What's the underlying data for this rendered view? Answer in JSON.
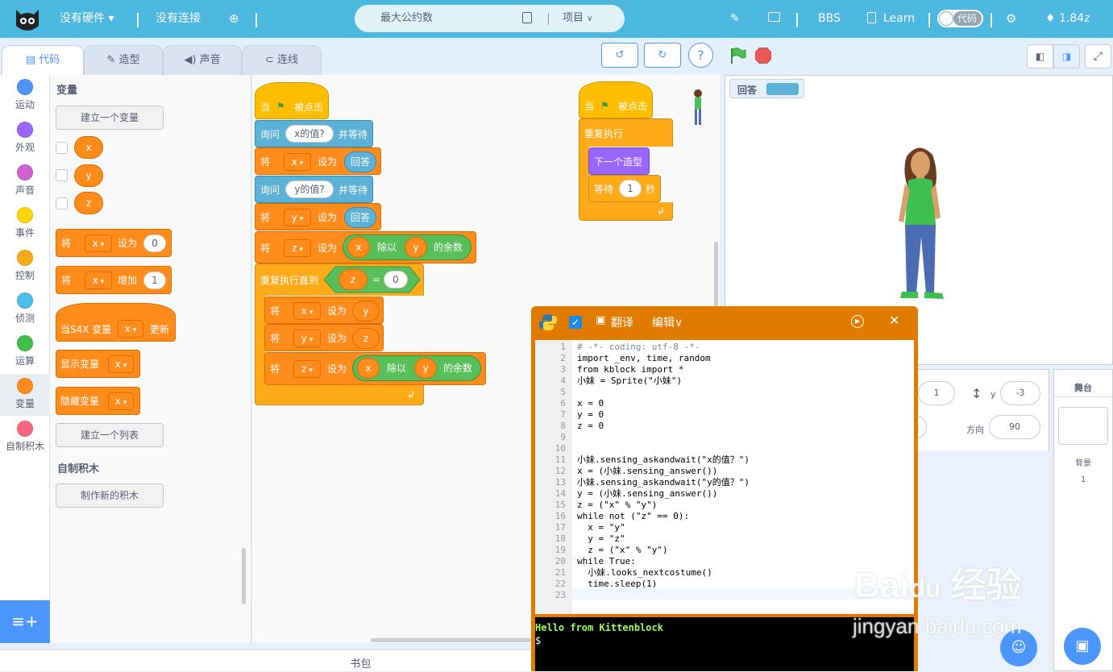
{
  "topbar": {
    "hardware": "没有硬件",
    "connection": "没有连接",
    "project_name": "最大公约数",
    "project_menu": "项目",
    "bbs": "BBS",
    "learn": "Learn",
    "code_toggle": "代码",
    "version": "1.84z"
  },
  "tabs": [
    "代码",
    "造型",
    "声音",
    "连线"
  ],
  "categories": [
    {
      "label": "运动",
      "color": "#4c97ff"
    },
    {
      "label": "外观",
      "color": "#9966ff"
    },
    {
      "label": "声音",
      "color": "#cf63cf"
    },
    {
      "label": "事件",
      "color": "#ffd500"
    },
    {
      "label": "控制",
      "color": "#ffab19"
    },
    {
      "label": "侦测",
      "color": "#4cbfe6"
    },
    {
      "label": "运算",
      "color": "#40bf4a"
    },
    {
      "label": "变量",
      "color": "#ff8c1a"
    },
    {
      "label": "自制积木",
      "color": "#ff6680"
    }
  ],
  "palette": {
    "variables_title": "变量",
    "make_variable": "建立一个变量",
    "vars": [
      "x",
      "y",
      "z"
    ],
    "set_block": {
      "op": "将",
      "var": "x",
      "mid": "设为",
      "val": "0"
    },
    "change_block": {
      "op": "将",
      "var": "x",
      "mid": "增加",
      "val": "1"
    },
    "when_var": {
      "pre": "当S4X 变量",
      "var": "x",
      "post": "更新"
    },
    "show_var": {
      "label": "显示变量",
      "var": "x"
    },
    "hide_var": {
      "label": "隐藏变量",
      "var": "x"
    },
    "make_list": "建立一个列表",
    "myblocks_title": "自制积木",
    "make_block": "制作新的积木"
  },
  "script1": {
    "hat": {
      "when": "当",
      "clicked": "被点击"
    },
    "ask1": {
      "label": "询问",
      "q": "x的值?",
      "post": "并等待"
    },
    "set_x": {
      "op": "将",
      "var": "x",
      "mid": "设为",
      "val": "回答"
    },
    "ask2": {
      "label": "询问",
      "q": "y的值?",
      "post": "并等待"
    },
    "set_y": {
      "op": "将",
      "var": "y",
      "mid": "设为",
      "val": "回答"
    },
    "set_z": {
      "op": "将",
      "var": "z",
      "mid": "设为",
      "a": "x",
      "b": "除以",
      "c": "y",
      "d": "的余数"
    },
    "repeat_until": {
      "label": "重复执行直到",
      "a": "z",
      "eq": "=",
      "b": "0"
    },
    "in1": {
      "op": "将",
      "var": "x",
      "mid": "设为",
      "val": "y"
    },
    "in2": {
      "op": "将",
      "var": "y",
      "mid": "设为",
      "val": "z"
    },
    "in3": {
      "op": "将",
      "var": "z",
      "mid": "设为",
      "a": "x",
      "b": "除以",
      "c": "y",
      "d": "的余数"
    }
  },
  "script2": {
    "hat": {
      "when": "当",
      "clicked": "被点击"
    },
    "forever": "重复执行",
    "next_costume": "下一个造型",
    "wait": {
      "label": "等待",
      "val": "1",
      "unit": "秒"
    }
  },
  "stage": {
    "monitor_label": "回答"
  },
  "sprite_info": {
    "x_val": "1",
    "y_label": "y",
    "y_val": "-3",
    "dir_label": "方向",
    "dir_val": "90"
  },
  "stage_panel": {
    "title": "舞台",
    "backdrop_label": "背景",
    "backdrop_count": "1"
  },
  "editor": {
    "translate": "翻译",
    "edit": "编辑",
    "lines": [
      "# -*- coding: utf-8 -*-",
      "import _env, time, random",
      "from kblock import *",
      "小妹 = Sprite(\"小妹\")",
      "",
      "x = 0",
      "y = 0",
      "z = 0",
      "",
      "",
      "小妹.sensing_askandwait(\"x的值？\")",
      "x = (小妹.sensing_answer())",
      "小妹.sensing_askandwait(\"y的值？\")",
      "y = (小妹.sensing_answer())",
      "z = (\"x\" % \"y\")",
      "while not (\"z\" == 0):",
      "  x = \"y\"",
      "  y = \"z\"",
      "  z = (\"x\" % \"y\")",
      "while True:",
      "  小妹.looks_nextcostume()",
      "  time.sleep(1)",
      ""
    ],
    "terminal_line1": "Hello from Kittenblock",
    "terminal_line2": "$"
  },
  "bottom_tab": "书包",
  "watermark": "Bai du 经验 jingyan.baidu.com"
}
